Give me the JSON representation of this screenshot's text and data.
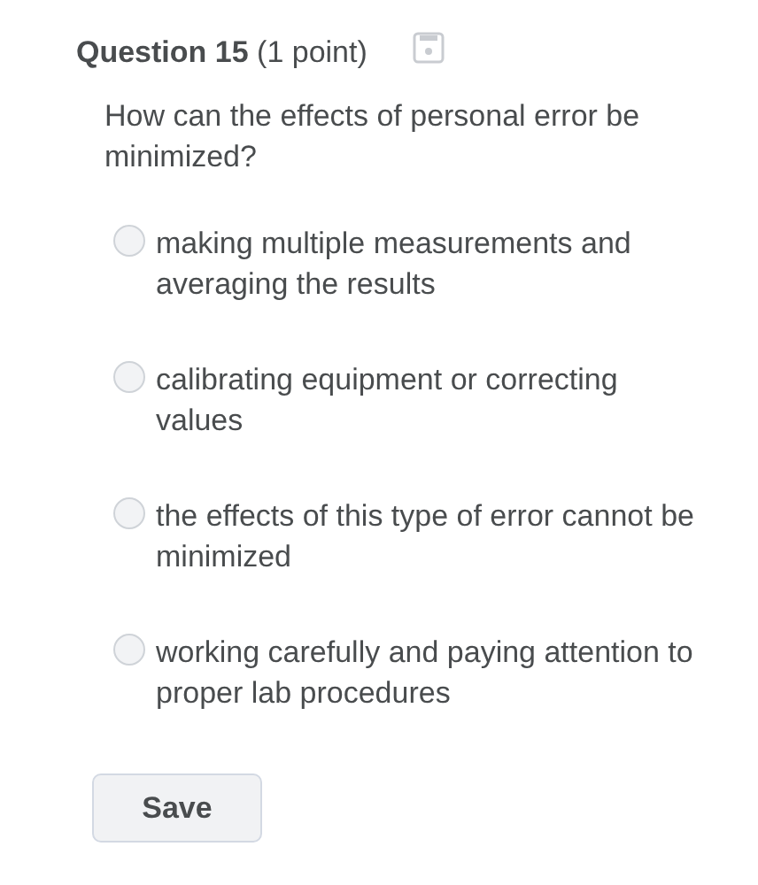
{
  "question": {
    "title": "**Question 15** (1 point)",
    "text": "How can the effects of personal error be minimized?"
  },
  "options": [
    {
      "label": "making multiple measurements and averaging the results",
      "selected": false
    },
    {
      "label": "calibrating equipment or correcting values",
      "selected": false
    },
    {
      "label": "the effects of this type of error cannot be minimized",
      "selected": false
    },
    {
      "label": "working carefully and paying attention to proper lab procedures",
      "selected": false
    }
  ],
  "buttons": [
    "Save"
  ]
}
